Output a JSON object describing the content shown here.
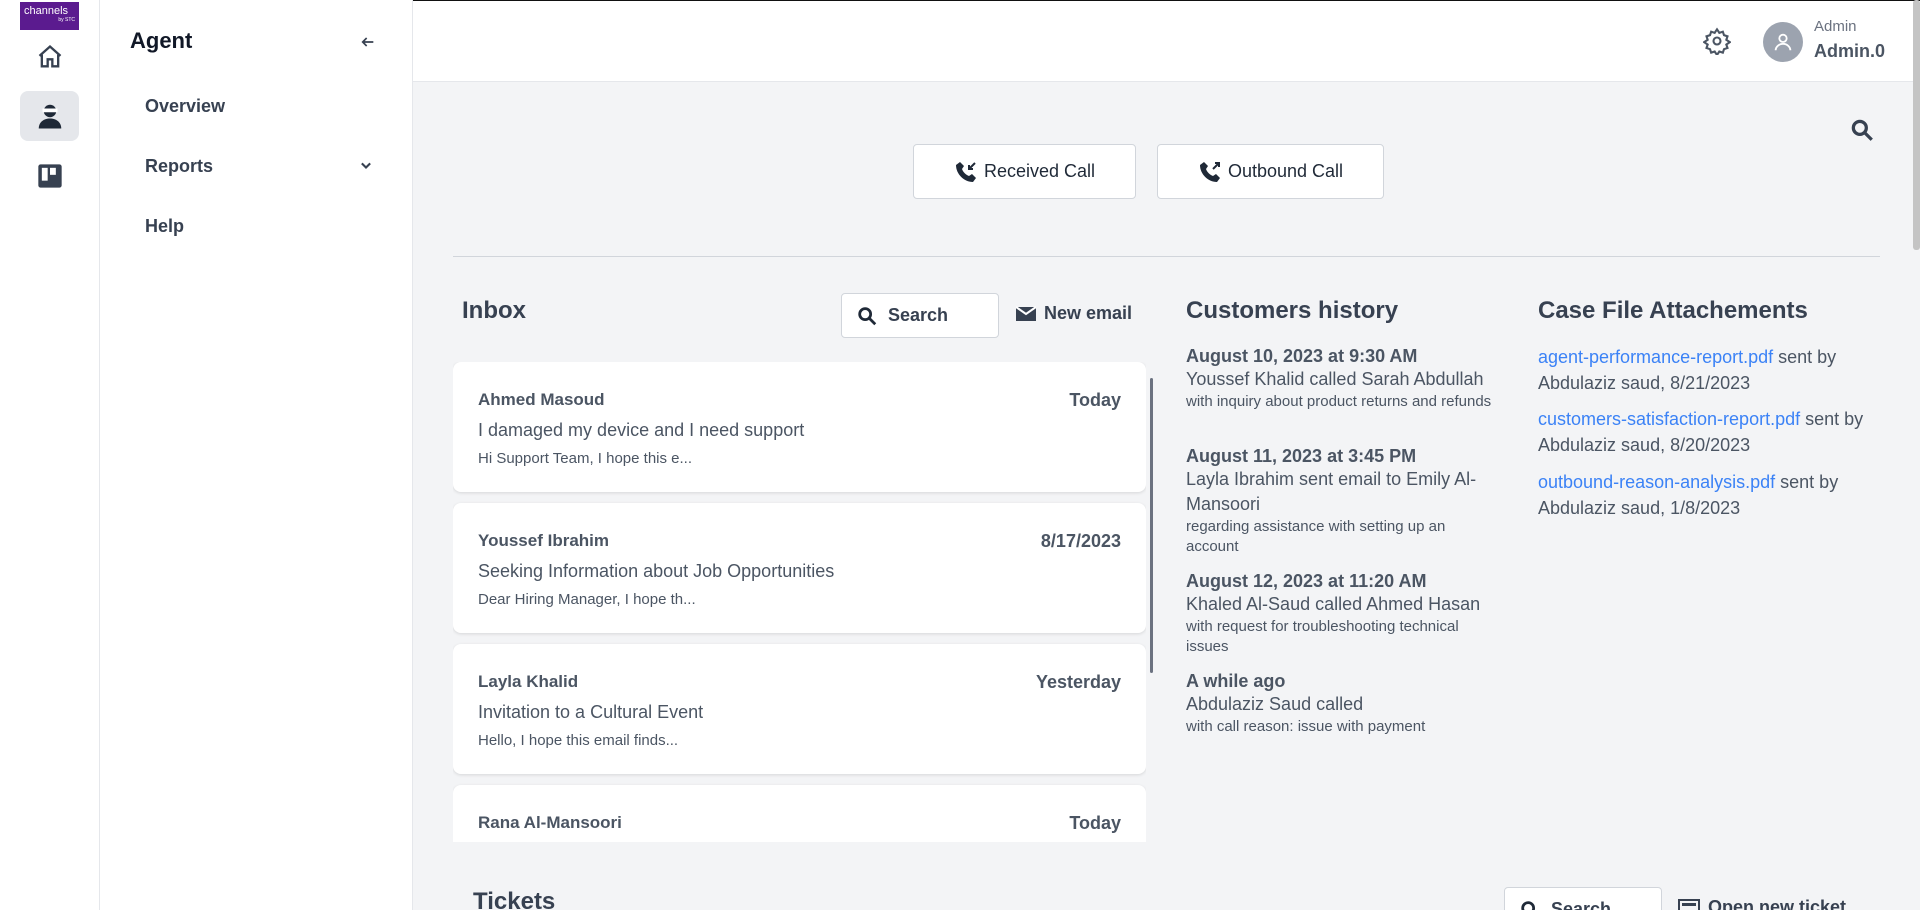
{
  "brand": {
    "logo_text": "channels",
    "logo_sub": "by STC"
  },
  "sidebar": {
    "title": "Agent",
    "items": [
      {
        "label": "Overview"
      },
      {
        "label": "Reports"
      },
      {
        "label": "Help"
      }
    ]
  },
  "header": {
    "user_role": "Admin",
    "user_name": "Admin.0"
  },
  "calls": {
    "received_label": "Received Call",
    "outbound_label": "Outbound Call"
  },
  "inbox": {
    "title": "Inbox",
    "search_label": "Search",
    "new_email_label": "New email",
    "emails": [
      {
        "sender": "Ahmed Masoud",
        "date": "Today",
        "subject": "I damaged my device and I need support",
        "preview": "Hi Support Team, I hope this e..."
      },
      {
        "sender": "Youssef Ibrahim",
        "date": "8/17/2023",
        "subject": "Seeking Information about Job Opportunities",
        "preview": "Dear Hiring Manager, I hope th..."
      },
      {
        "sender": "Layla Khalid",
        "date": "Yesterday",
        "subject": "Invitation to a Cultural Event",
        "preview": "Hello, I hope this email finds..."
      },
      {
        "sender": "Rana Al-Mansoori",
        "date": "Today",
        "subject": "",
        "preview": ""
      }
    ]
  },
  "history": {
    "title": "Customers history",
    "entries": [
      {
        "time": "August 10, 2023 at 9:30 AM",
        "text": "Youssef Khalid called Sarah Abdullah",
        "detail": "with inquiry about product returns and refunds"
      },
      {
        "time": "August 11, 2023 at 3:45 PM",
        "text": "Layla Ibrahim sent email to Emily Al-Mansoori",
        "detail": "regarding assistance with setting up an account"
      },
      {
        "time": "August 12, 2023 at 11:20 AM",
        "text": "Khaled Al-Saud called Ahmed Hasan",
        "detail": "with request for troubleshooting technical issues"
      },
      {
        "time": "A while ago",
        "text": "Abdulaziz Saud called",
        "detail": "with call reason: issue with payment"
      }
    ]
  },
  "attachments": {
    "title": "Case File Attachements",
    "items": [
      {
        "file": "agent-performance-report.pdf",
        "meta": " sent by Abdulaziz saud, 8/21/2023"
      },
      {
        "file": "customers-satisfaction-report.pdf",
        "meta": " sent by Abdulaziz saud, 8/20/2023"
      },
      {
        "file": "outbound-reason-analysis.pdf",
        "meta": " sent by Abdulaziz saud, 1/8/2023"
      }
    ]
  },
  "tickets": {
    "title": "Tickets",
    "search_label": "Search",
    "new_ticket_label": "Open new ticket"
  },
  "icons": {
    "home": "home-icon",
    "agent": "agent-icon",
    "board": "board-icon",
    "back": "arrow-left-icon",
    "chevron": "chevron-down-icon",
    "settings": "gear-icon",
    "avatar": "user-icon",
    "search": "search-icon",
    "received_call": "phone-incoming-icon",
    "outbound_call": "phone-outgoing-icon",
    "mail": "mail-icon",
    "ticket": "ticket-icon"
  },
  "colors": {
    "brand": "#5b1b8f",
    "link": "#3b82f6",
    "background": "#f3f4f6"
  }
}
